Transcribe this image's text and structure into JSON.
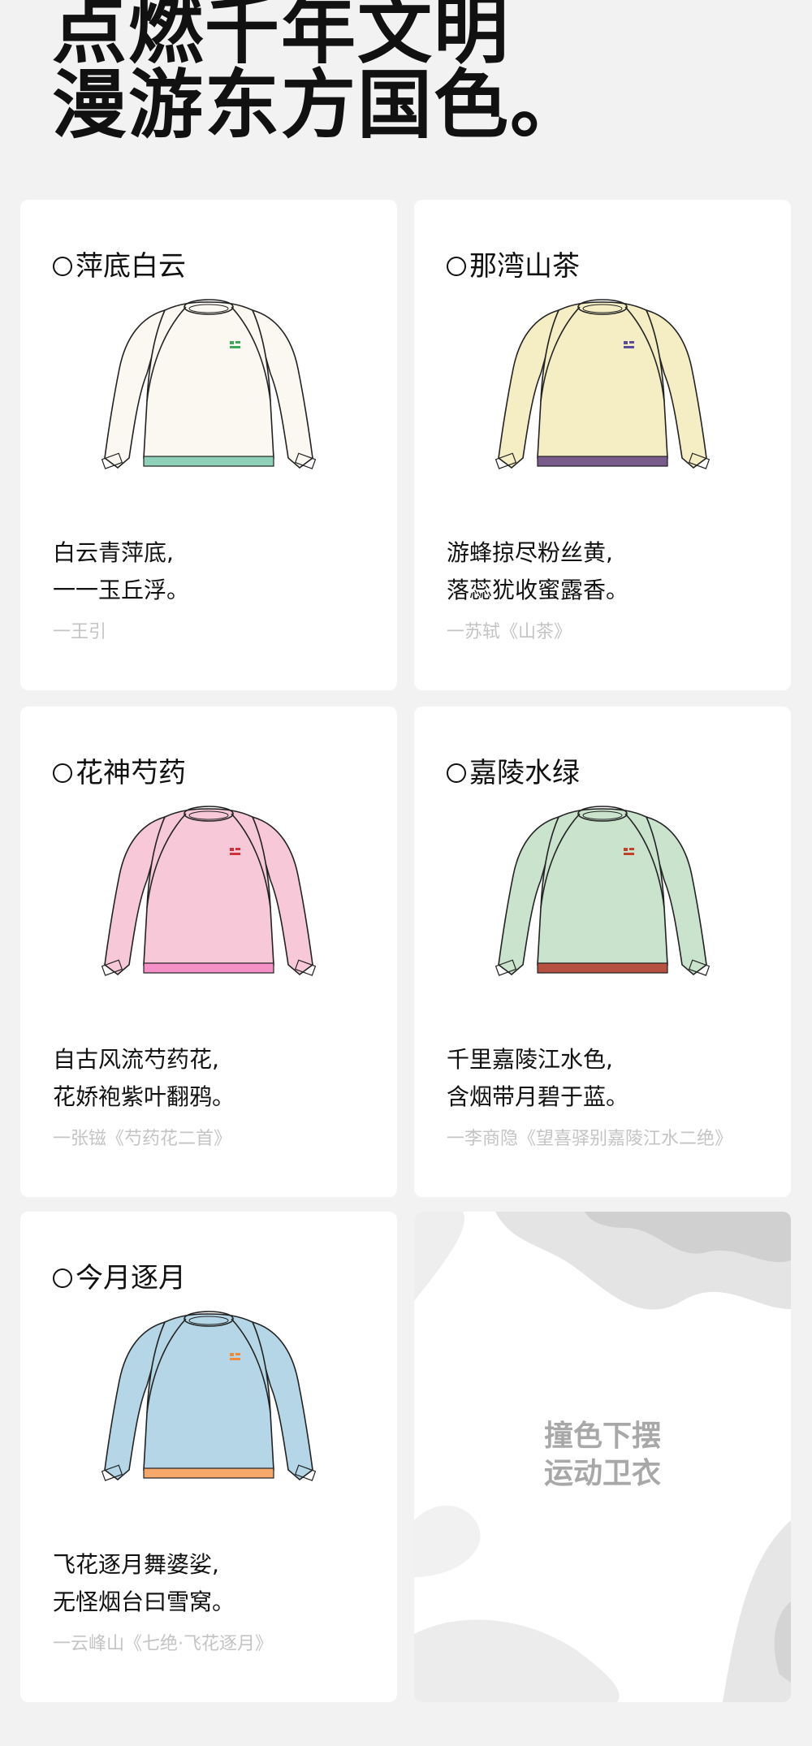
{
  "headline": {
    "line1": "点燃千年文明",
    "line2": "漫游东方国色。"
  },
  "cards": [
    {
      "title": "萍底白云",
      "poem_line1": "白云青萍底,",
      "poem_line2": "一一玉丘浮。",
      "source": "一王引",
      "body_color": "#fbf8f1",
      "hem_color": "#8fd1b8",
      "logo_color": "#3aaa5a"
    },
    {
      "title": "那湾山茶",
      "poem_line1": "游蜂掠尽粉丝黄,",
      "poem_line2": "落蕊犹收蜜露香。",
      "source": "一苏轼《山茶》",
      "body_color": "#f5eec5",
      "hem_color": "#7a5c8c",
      "logo_color": "#5a4aa0"
    },
    {
      "title": "花神芍药",
      "poem_line1": "自古风流芍药花,",
      "poem_line2": "花娇袍紫叶翻鸦。",
      "source": "一张镃《芍药花二首》",
      "body_color": "#f7c9d8",
      "hem_color": "#f590c8",
      "logo_color": "#d0303a"
    },
    {
      "title": "嘉陵水绿",
      "poem_line1": "千里嘉陵江水色,",
      "poem_line2": "含烟带月碧于蓝。",
      "source": "一李商隐《望喜驿别嘉陵江水二绝》",
      "body_color": "#c9e3cd",
      "hem_color": "#b65040",
      "logo_color": "#c0402a"
    },
    {
      "title": "今月逐月",
      "poem_line1": "飞花逐月舞婆娑,",
      "poem_line2": "无怪烟台曰雪窝。",
      "source": "一云峰山《七绝·飞花逐月》",
      "body_color": "#b4d6e6",
      "hem_color": "#f5a86a",
      "logo_color": "#f08a3a"
    }
  ],
  "promo": {
    "line1": "撞色下摆",
    "line2": "运动卫衣"
  }
}
